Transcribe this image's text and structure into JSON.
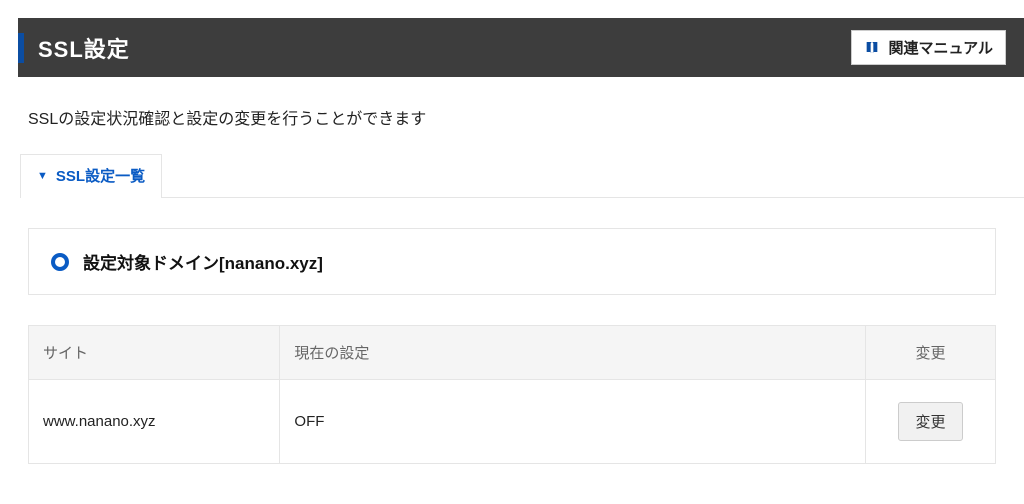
{
  "header": {
    "title": "SSL設定",
    "manual_button": "関連マニュアル"
  },
  "description": "SSLの設定状況確認と設定の変更を行うことができます",
  "tab": {
    "label": "SSL設定一覧"
  },
  "domain_panel": {
    "label": "設定対象ドメイン[nanano.xyz]"
  },
  "table": {
    "headers": {
      "site": "サイト",
      "current": "現在の設定",
      "change": "変更"
    },
    "rows": [
      {
        "site": "www.nanano.xyz",
        "current": "OFF",
        "change_btn": "変更"
      }
    ]
  }
}
